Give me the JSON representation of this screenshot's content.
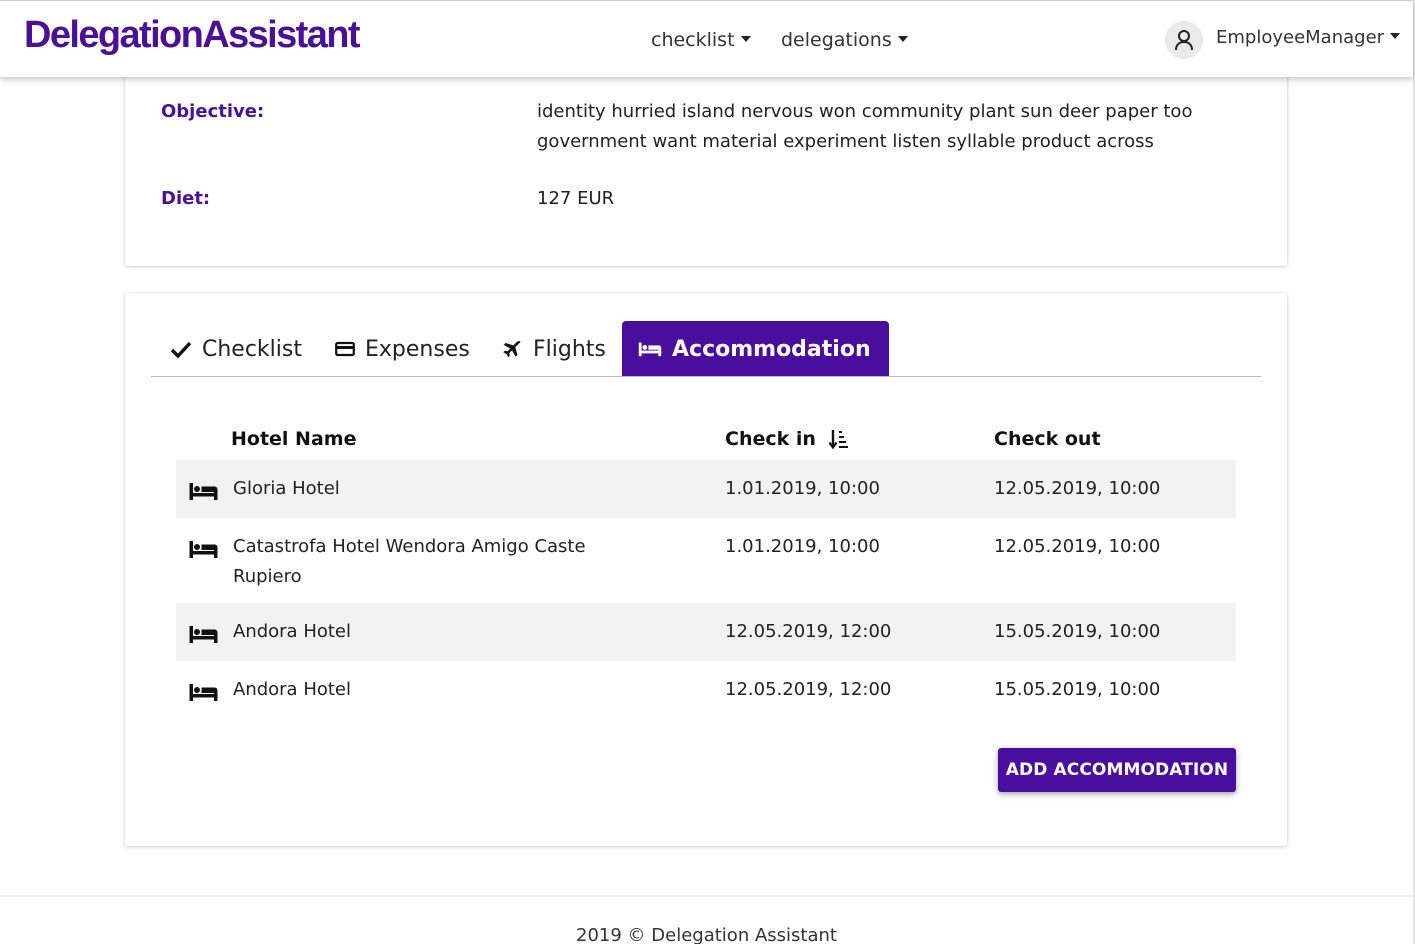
{
  "navbar": {
    "brand": "DelegationAssistant",
    "menu": [
      {
        "label": "checklist"
      },
      {
        "label": "delegations"
      }
    ],
    "user": "EmployeeManager"
  },
  "details": {
    "objective_label": "Objective:",
    "objective_line1": "identity hurried island nervous won community plant sun deer paper too",
    "objective_line2": "government want material experiment listen syllable product across",
    "diet_label": "Diet:",
    "diet_value": "127 EUR"
  },
  "tabs": [
    {
      "label": "Checklist",
      "icon": "check-icon",
      "active": false
    },
    {
      "label": "Expenses",
      "icon": "credit-card-icon",
      "active": false
    },
    {
      "label": "Flights",
      "icon": "plane-icon",
      "active": false
    },
    {
      "label": "Accommodation",
      "icon": "bed-icon",
      "active": true
    }
  ],
  "table": {
    "headers": {
      "hotel": "Hotel Name",
      "check_in": "Check in",
      "check_out": "Check out"
    },
    "sort_icon": "sort-ascending-icon",
    "rows": [
      {
        "hotel_line1": "Gloria Hotel",
        "hotel_line2": "",
        "check_in": "1.01.2019, 10:00",
        "check_out": "12.05.2019, 10:00"
      },
      {
        "hotel_line1": "Catastrofa Hotel Wendora Amigo Caste",
        "hotel_line2": "Rupiero",
        "check_in": "1.01.2019, 10:00",
        "check_out": "12.05.2019, 10:00"
      },
      {
        "hotel_line1": "Andora Hotel",
        "hotel_line2": "",
        "check_in": "12.05.2019, 12:00",
        "check_out": "15.05.2019, 10:00"
      },
      {
        "hotel_line1": "Andora Hotel",
        "hotel_line2": "",
        "check_in": "12.05.2019, 12:00",
        "check_out": "15.05.2019, 10:00"
      }
    ]
  },
  "add_button": "ADD ACCOMMODATION",
  "footer": "2019 © Delegation Assistant",
  "colors": {
    "accent": "#4a0e9e",
    "row_stripe": "#f2f2f2"
  }
}
